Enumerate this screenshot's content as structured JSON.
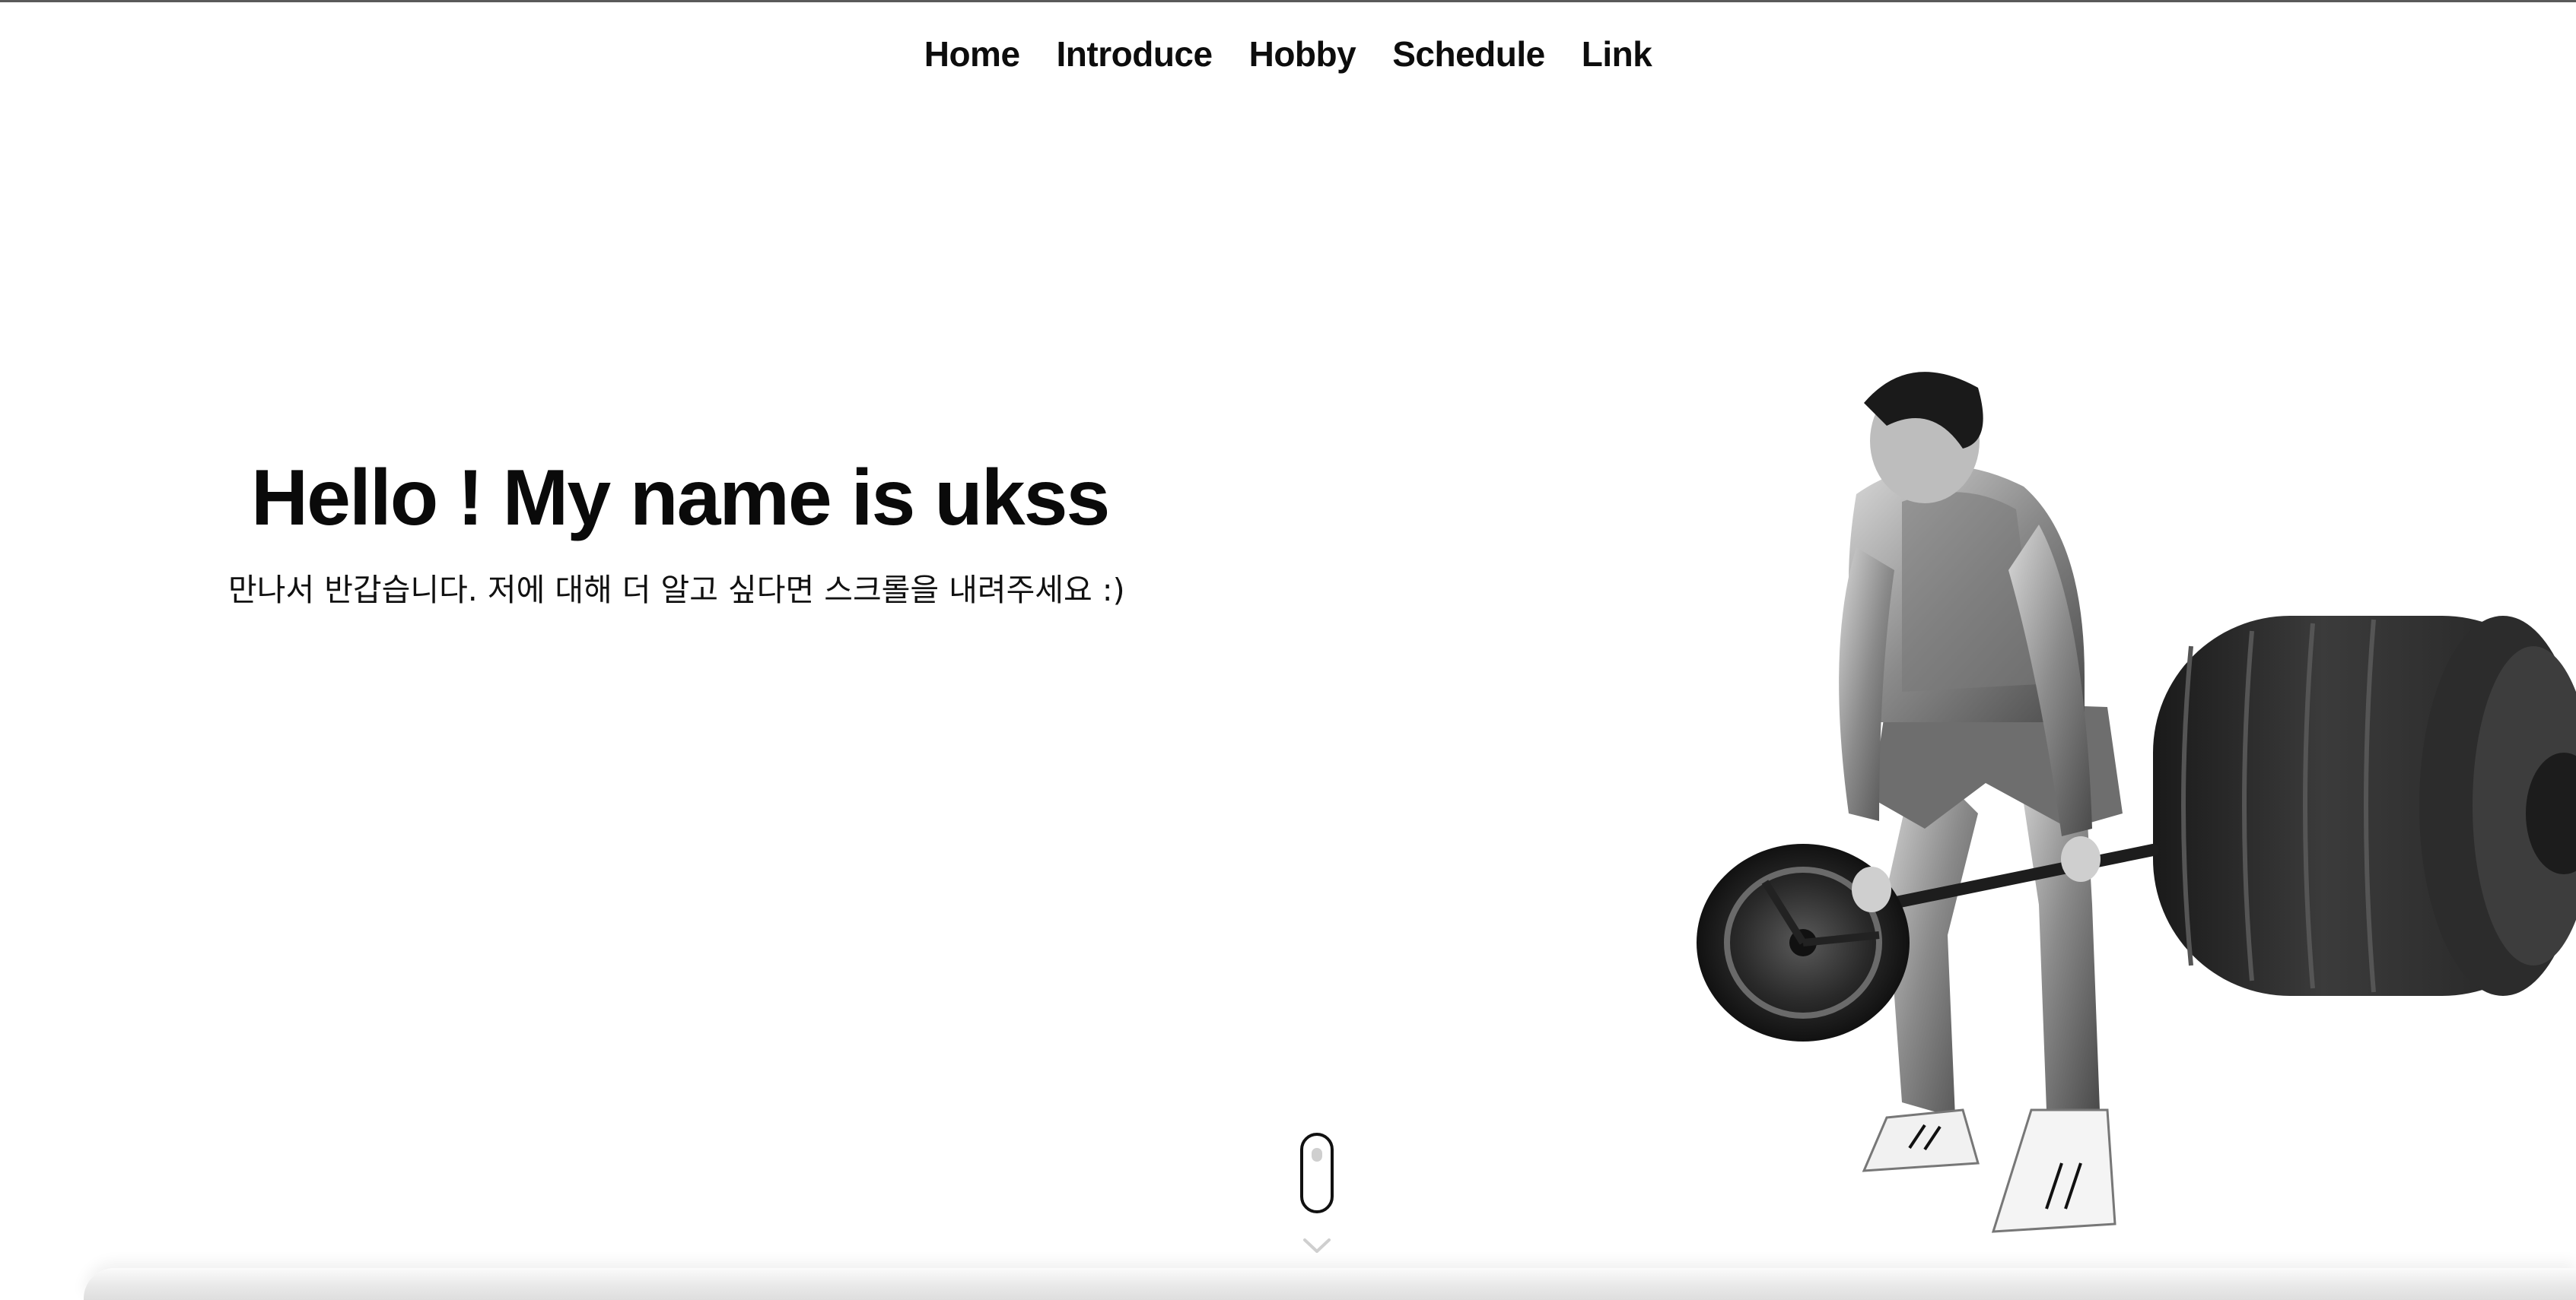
{
  "nav": {
    "items": [
      {
        "label": "Home"
      },
      {
        "label": "Introduce"
      },
      {
        "label": "Hobby"
      },
      {
        "label": "Schedule"
      },
      {
        "label": "Link"
      }
    ]
  },
  "hero": {
    "title": "Hello ! My name is ukss",
    "subtitle": "만나서 반갑습니다. 저에 대해 더 알고 싶다면 스크롤을 내려주세요 :)"
  },
  "scroll_indicator": {
    "icon": "mouse-scroll-icon",
    "chevron_icon": "chevron-down-icon"
  },
  "image": {
    "subject": "weightlifter-deadlift-photo"
  },
  "colors": {
    "background": "#ffffff",
    "text": "#111111",
    "accent_gray": "#cfcfcf"
  }
}
